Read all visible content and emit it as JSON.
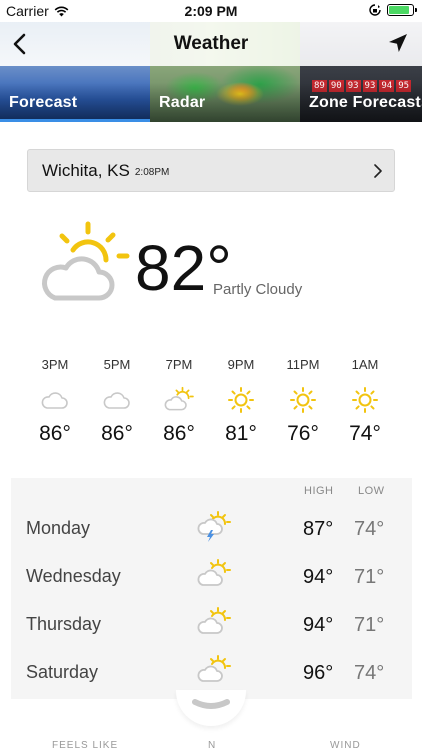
{
  "status_bar": {
    "carrier": "Carrier",
    "time": "2:09 PM",
    "battery_level": 0.85,
    "battery_color": "#4cd964"
  },
  "header": {
    "title": "Weather",
    "back_icon": "chevron-left-icon",
    "location_icon": "location-arrow-icon"
  },
  "tabs": [
    {
      "label": "Forecast",
      "active": true
    },
    {
      "label": "Radar",
      "active": false
    },
    {
      "label": "Zone Forecasts",
      "active": false
    }
  ],
  "zone_thumbnail_numbers": [
    "89",
    "90",
    "93",
    "93",
    "94",
    "95"
  ],
  "accent_color": "#3a8ee6",
  "location": {
    "city": "Wichita, KS",
    "time": "2:08PM"
  },
  "current": {
    "temp": "82°",
    "condition": "Partly Cloudy",
    "icon": "partly-cloudy-icon"
  },
  "hourly": [
    {
      "time": "3PM",
      "temp": "86°",
      "icon": "cloudy-icon"
    },
    {
      "time": "5PM",
      "temp": "86°",
      "icon": "cloudy-icon"
    },
    {
      "time": "7PM",
      "temp": "86°",
      "icon": "partly-cloudy-icon"
    },
    {
      "time": "9PM",
      "temp": "81°",
      "icon": "sun-icon"
    },
    {
      "time": "11PM",
      "temp": "76°",
      "icon": "sun-icon"
    },
    {
      "time": "1AM",
      "temp": "74°",
      "icon": "sun-icon"
    }
  ],
  "daily": {
    "high_label": "HIGH",
    "low_label": "LOW",
    "days": [
      {
        "day": "Monday",
        "high": "87°",
        "low": "74°",
        "icon": "thunderstorm-icon"
      },
      {
        "day": "Wednesday",
        "high": "94°",
        "low": "71°",
        "icon": "partly-cloudy-icon"
      },
      {
        "day": "Thursday",
        "high": "94°",
        "low": "71°",
        "icon": "partly-cloudy-icon"
      },
      {
        "day": "Saturday",
        "high": "96°",
        "low": "74°",
        "icon": "partly-cloudy-icon"
      }
    ]
  },
  "bottom_labels": {
    "feels_like": "FEELS LIKE",
    "wind_dir": "N",
    "wind": "WIND"
  }
}
